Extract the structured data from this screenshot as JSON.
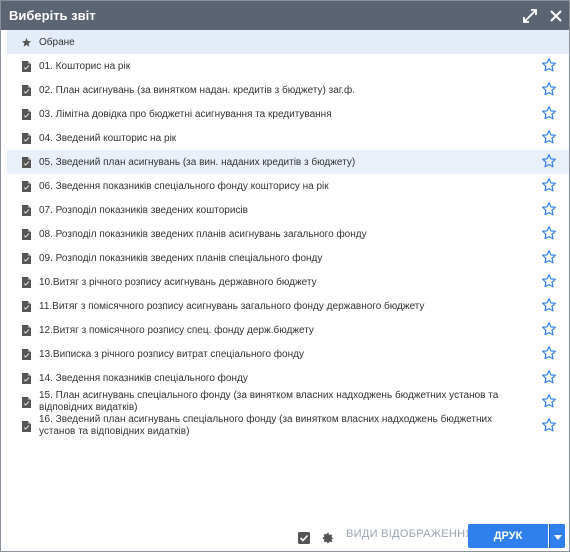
{
  "window": {
    "title": "Виберіть звіт",
    "maximize_icon": "maximize-icon",
    "close_icon": "close-icon"
  },
  "favorites": {
    "label": "Обране",
    "icon": "star-filled-icon"
  },
  "reports": [
    {
      "label": "01. Кошторис на рік"
    },
    {
      "label": "02. План асигнувань (за винятком надан. кредитів з бюджету) заг.ф."
    },
    {
      "label": "03. Лімітна довідка про бюджетні асигнування та кредитування"
    },
    {
      "label": "04. Зведений кошторис на рік"
    },
    {
      "label": "05. Зведений план асигнувань (за вин. наданих кредитів з бюджету)"
    },
    {
      "label": "06. Зведення показників спеціального фонду кошторису на рік"
    },
    {
      "label": "07. Розподіл показників зведених кошторисів"
    },
    {
      "label": "08. Розподіл показників зведених планів асигнувань загального фонду"
    },
    {
      "label": "09. Розподіл показників зведених планів спеціального фонду"
    },
    {
      "label": "10.Витяг з річного розпису асигнувань державного бюджету"
    },
    {
      "label": "11.Витяг з помісячного розпису асигнувань загального фонду державного бюджету"
    },
    {
      "label": "12.Витяг з помісячного розпису спец. фонду держ.бюджету"
    },
    {
      "label": "13.Виписка з річного розпису витрат спеціального фонду"
    },
    {
      "label": "14. Зведення показників спеціального фонду"
    },
    {
      "label": "15. План асигнувань спеціального фонду (за винятком власних надходжень бюджетних установ та відповідних видатків)"
    },
    {
      "label": "16. Зведений план асигнувань спеціального фонду (за винятком власних надходжень бюджетних установ та відповідних видатків)"
    }
  ],
  "footer": {
    "view_modes_label": "ВИДИ ВІДОБРАЖЕННЯ",
    "print_label": "ДРУК"
  },
  "colors": {
    "titlebar": "#5a6472",
    "accent": "#2f80ed",
    "star": "#2f80ed"
  }
}
